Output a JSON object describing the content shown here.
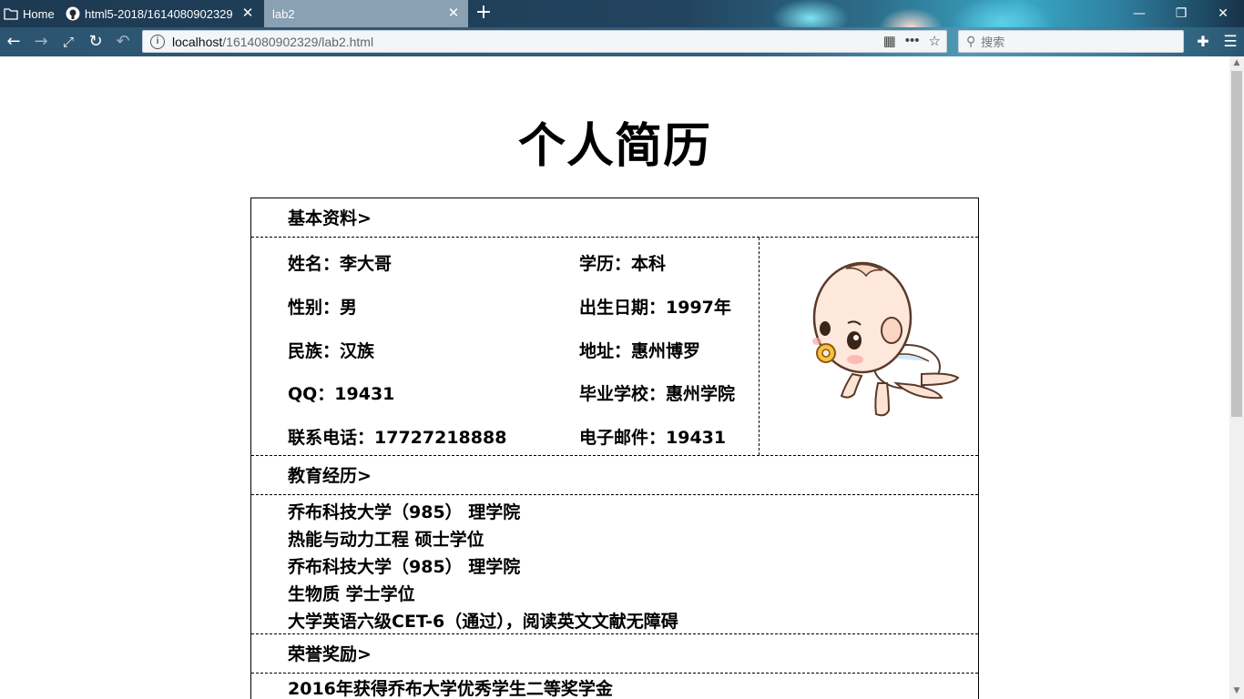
{
  "browser": {
    "tabs": [
      {
        "label": "Home"
      },
      {
        "label": "html5-2018/1614080902329"
      },
      {
        "label": "lab2"
      }
    ],
    "url_host": "localhost",
    "url_path": "/1614080902329/lab2.html",
    "search_placeholder": "搜索"
  },
  "page": {
    "title": "个人简历",
    "basic_header": "基本资料>",
    "basic": {
      "name": "姓名：李大哥",
      "education": "学历：本科",
      "gender": "性别：男",
      "birth": "出生日期：1997年",
      "ethnicity": "民族：汉族",
      "address": "地址：惠州博罗",
      "qq": "QQ：19431",
      "school": "毕业学校：惠州学院",
      "phone": "联系电话：17727218888",
      "email": "电子邮件：19431"
    },
    "edu_header": "教育经历>",
    "edu": [
      "乔布科技大学（985） 理学院",
      "热能与动力工程 硕士学位",
      "乔布科技大学（985） 理学院",
      "生物质 学士学位",
      "大学英语六级CET-6（通过），阅读英文文献无障碍"
    ],
    "award_header": "荣誉奖励>",
    "awards": [
      "2016年获得乔布大学优秀学生二等奖学金"
    ]
  }
}
